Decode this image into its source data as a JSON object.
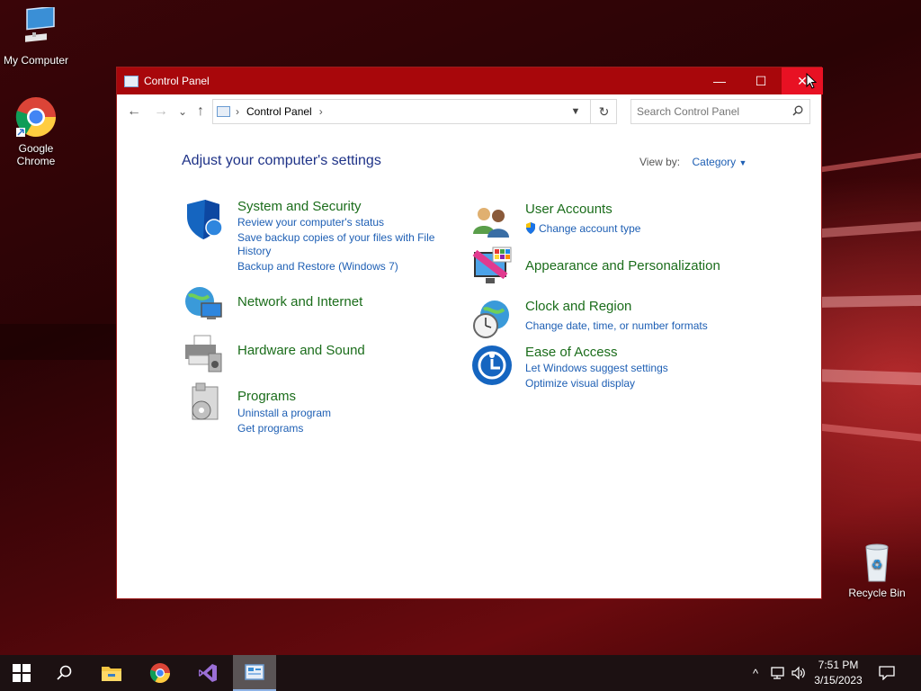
{
  "desktop": {
    "icons": [
      {
        "label": "My Computer",
        "icon": "computer-icon"
      },
      {
        "label": "Google Chrome",
        "icon": "chrome-icon"
      },
      {
        "label": "Recycle Bin",
        "icon": "recycle-bin-icon"
      }
    ]
  },
  "window": {
    "title": "Control Panel",
    "controls": {
      "minimize": "—",
      "maximize": "☐",
      "close": "✕"
    }
  },
  "navigation": {
    "back": "←",
    "forward": "→",
    "recent": "⌄",
    "up": "↑",
    "breadcrumb": [
      "Control Panel"
    ],
    "separator": "›",
    "refresh": "↻",
    "search_placeholder": "Search Control Panel"
  },
  "content": {
    "heading": "Adjust your computer's settings",
    "view_by_label": "View by:",
    "view_by_value": "Category",
    "categories_left": [
      {
        "title": "System and Security",
        "icon": "shield-icon",
        "links": [
          "Review your computer's status",
          "Save backup copies of your files with File",
          "History",
          "Backup and Restore (Windows 7)"
        ]
      },
      {
        "title": "Network and Internet",
        "icon": "network-globe-icon",
        "links": []
      },
      {
        "title": "Hardware and Sound",
        "icon": "printer-icon",
        "links": []
      },
      {
        "title": "Programs",
        "icon": "programs-icon",
        "links": [
          "Uninstall a program",
          "Get programs"
        ]
      }
    ],
    "categories_right": [
      {
        "title": "User Accounts",
        "icon": "users-icon",
        "links": [
          "Change account type"
        ]
      },
      {
        "title": "Appearance and Personalization",
        "icon": "monitor-palette-icon",
        "links": []
      },
      {
        "title": "Clock and Region",
        "icon": "clock-globe-icon",
        "links": [
          "Change date, time, or number formats"
        ]
      },
      {
        "title": "Ease of Access",
        "icon": "ease-of-access-icon",
        "links": [
          "Let Windows suggest settings",
          "Optimize visual display"
        ]
      }
    ]
  },
  "taskbar": {
    "items": [
      "start-icon",
      "search-icon",
      "file-explorer-icon",
      "chrome-icon",
      "visual-studio-icon",
      "control-panel-icon"
    ],
    "tray": {
      "chevron": "^",
      "time": "7:51 PM",
      "date": "3/15/2023"
    }
  },
  "colors": {
    "titlebar": "#a8070b",
    "close_hover": "#e81123",
    "category_title": "#1b6d1b",
    "link": "#1e5fb4",
    "heading": "#1e3287"
  }
}
